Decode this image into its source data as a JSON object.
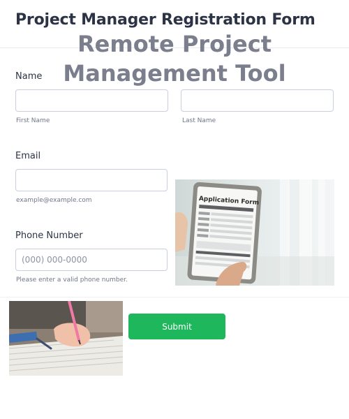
{
  "form": {
    "title": "Project Manager Registration Form",
    "overlay_title": "Remote Project Management Tool"
  },
  "name_field": {
    "label": "Name",
    "first": {
      "value": "",
      "placeholder": "",
      "sublabel": "First Name"
    },
    "last": {
      "value": "",
      "placeholder": "",
      "sublabel": "Last Name"
    }
  },
  "email_field": {
    "label": "Email",
    "value": "",
    "placeholder": "",
    "sublabel": "example@example.com"
  },
  "phone_field": {
    "label": "Phone Number",
    "value": "",
    "placeholder": "(000) 000-0000",
    "sublabel": "Please enter a valid phone number."
  },
  "images": {
    "tablet_heading": "Application Form"
  },
  "submit": {
    "label": "Submit"
  },
  "colors": {
    "accent": "#1fb75b",
    "title": "#2c3345",
    "overlay": "#7b7e8c",
    "input_border": "#c9cfdc"
  }
}
